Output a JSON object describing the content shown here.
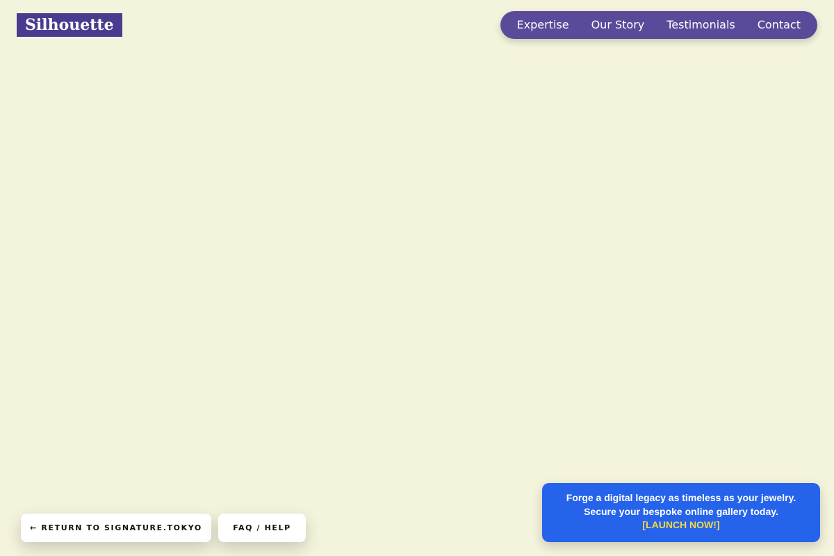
{
  "header": {
    "logo": "Silhouette"
  },
  "nav": {
    "items": [
      {
        "label": "Expertise"
      },
      {
        "label": "Our Story"
      },
      {
        "label": "Testimonials"
      },
      {
        "label": "Contact"
      }
    ]
  },
  "footer_buttons": {
    "return_label": "← RETURN TO SIGNATURE.TOKYO",
    "faq_label": "FAQ / HELP"
  },
  "promo": {
    "line1": "Forge a digital legacy as timeless as your jewelry.",
    "line2": "Secure your bespoke online gallery today.",
    "cta": "[LAUNCH NOW!]"
  },
  "colors": {
    "background": "#f4f3dc",
    "logo_bg": "#4a3b8f",
    "nav_bg": "#5b4a9a",
    "promo_bg": "#2563eb",
    "cta_text": "#f6d743"
  }
}
